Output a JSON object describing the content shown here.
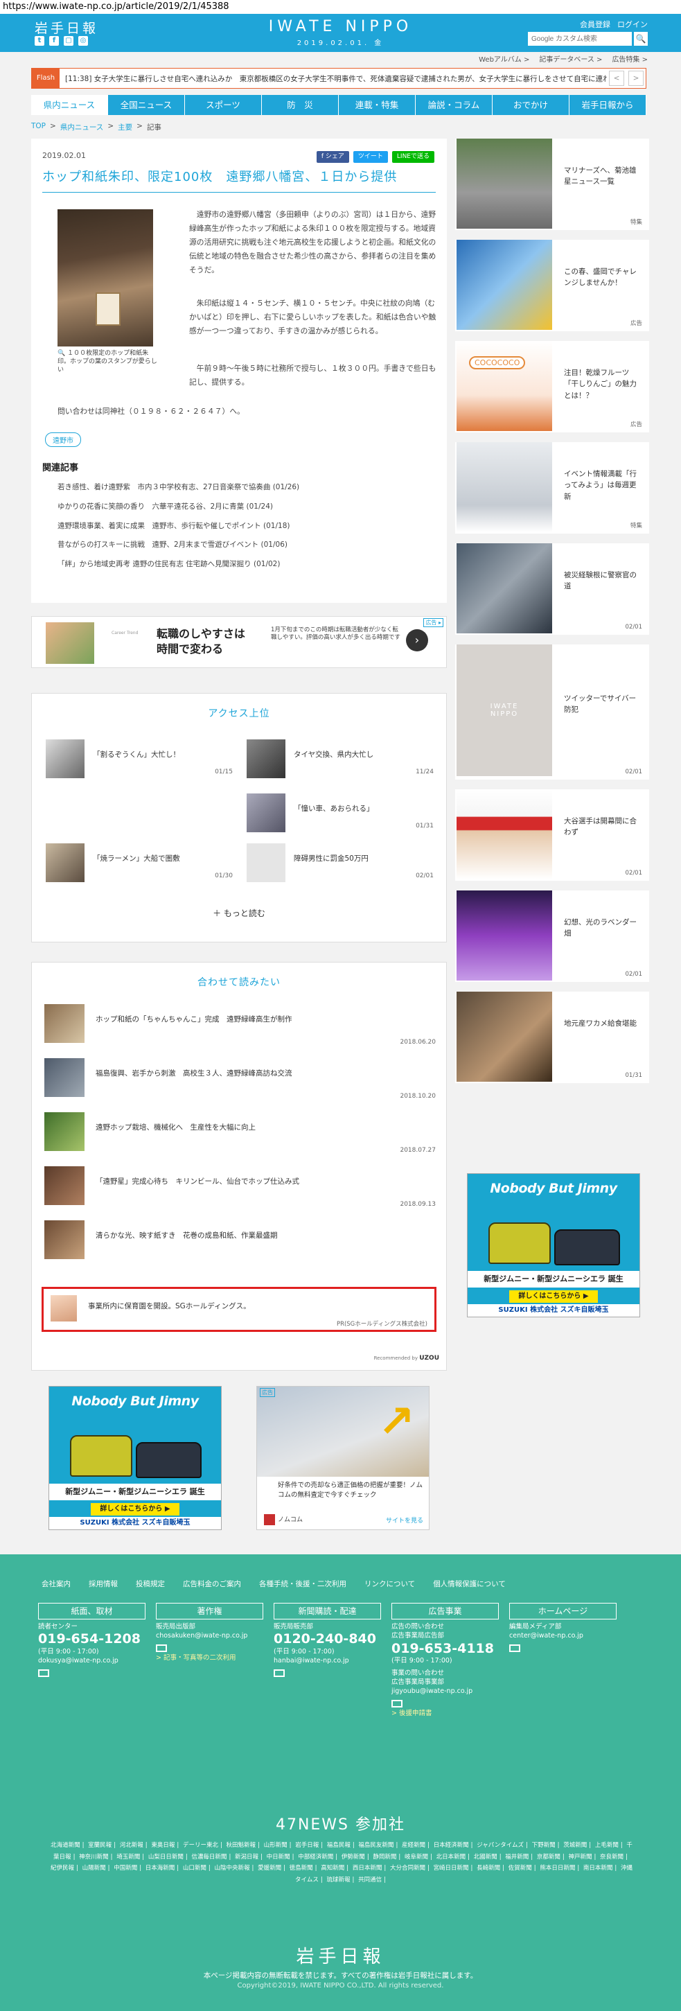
{
  "url": "https://www.iwate-np.co.jp/article/2019/2/1/45388",
  "header": {
    "logo": "岩手日報",
    "social": [
      "t",
      "f",
      "▢",
      "◎"
    ],
    "brand": "IWATE NIPPO",
    "date": "2019.02.01. 金",
    "account": [
      "会員登録",
      "ログイン"
    ],
    "search_placeholder": "Google カスタム検索",
    "search_btn": "🔍",
    "utility": [
      "Webアルバム >",
      "記事データベース >",
      "広告特集 >"
    ]
  },
  "flash": {
    "label": "Flash",
    "text": "[11:38] 女子大学生に暴行しさせ自宅へ連れ込みか　東京都板橋区の女子大学生不明事件で、死体遺棄容疑で逮捕された男が、女子大学生に暴行しをさせて自宅に連れ…",
    "prev": "<",
    "next": ">"
  },
  "nav": [
    "県内ニュース",
    "全国ニュース",
    "スポーツ",
    "防　災",
    "連載・特集",
    "論説・コラム",
    "おでかけ",
    "岩手日報から"
  ],
  "breadcrumb": [
    "TOP",
    ">",
    "県内ニュース",
    ">",
    "主要",
    ">",
    "記事"
  ],
  "article": {
    "date": "2019.02.01",
    "share": [
      "f シェア",
      "ツイート",
      "LINEで送る"
    ],
    "title": "ホップ和紙朱印、限定100枚　遠野郷八幡宮、１日から提供",
    "caption": "１００枚限定のホップ和紙朱印。ホップの葉のスタンプが愛らしい",
    "paragraphs": [
      "遠野市の遠野郷八幡宮（多田頼申（よりのぶ）宮司）は１日から、遠野緑峰高生が作ったホップ和紙による朱印１００枚を限定授与する。地域資源の活用研究に挑戦も注ぐ地元高校生を応援しようと初企画。和紙文化の伝統と地域の特色を融合させた希少性の高さから、参拝者らの注目を集めそうだ。",
      "朱印紙は縦１４・５センチ、横１０・５センチ。中央に社紋の向鳩（むかいばと）印を押し、右下に愛らしいホップを表した。和紙は色合いや触感が一つ一つ違っており、手すきの温かみが感じられる。",
      "午前９時～午後５時に社務所で授与し、１枚３００円。手書きで些日も記し、提供する。"
    ],
    "contact": "問い合わせは同神社（０１９８・６２・２６４７）へ。",
    "tag": "遠野市",
    "related_title": "関連記事",
    "related": [
      "若き感性、着け遠野紫　市内３中学校有志、27日音楽祭で協奏曲 (01/26)",
      "ゆかりの花香に笑顔の香り　六華平遠花る谷、2月に青葉 (01/24)",
      "遠野環境事業、着実に成果　遠野市、歩行転や催しでポイント (01/18)",
      "昔ながらの打スキーに挑戦　遠野、2月末まで雪遊びイベント (01/06)",
      "「絆」から地域史再考 遠野の住民有志 住宅跡へ見聞深掘り (01/02)"
    ]
  },
  "ad_banner": {
    "label": "広告 ▸",
    "brand": "Career Trend",
    "headline_1": "転職のしやすさは",
    "headline_2": "時間で変わる",
    "side": "1月下旬までのこの時期は転職活動者が少なく転職しやすい。評価の高い求人が多く出る時期です",
    "arrow": "›"
  },
  "access": {
    "title": "アクセス上位",
    "items": [
      {
        "text": "「割るぞうくん」大忙し！",
        "date": "01/15"
      },
      {
        "text": "タイヤ交換、県内大忙し",
        "date": "11/24"
      },
      {
        "text": "「憧い車、あおられる」",
        "date": "01/31"
      },
      {
        "text": "「焼ラーメン」大船で圏敷",
        "date": "01/30"
      },
      {
        "text": "障碍男性に罰金50万円",
        "date": "02/01"
      }
    ],
    "more": "＋ もっと読む"
  },
  "recommend": {
    "title": "合わせて読みたい",
    "items": [
      {
        "text": "ホップ和紙の「ちゃんちゃんこ」完成　遠野緑峰高生が制作",
        "date": "2018.06.20"
      },
      {
        "text": "福島復興、岩手から刺激　高校生３人、遠野緑峰高訪ね交流",
        "date": "2018.10.20"
      },
      {
        "text": "遠野ホップ栽培、機械化へ　生産性を大幅に向上",
        "date": "2018.07.27"
      },
      {
        "text": "「遠野星」完成心待ち　キリンビール、仙台でホップ仕込み式",
        "date": "2018.09.13"
      },
      {
        "text": "清らかな光、映す紙すき　花巻の成島和紙、作業最盛期",
        "date": ""
      }
    ],
    "ad": {
      "text": "事業所内に保育園を開設。SGホールディングス。",
      "source": "PR(SGホールディングス株式会社)"
    },
    "powered_label": "Recommended by",
    "powered_brand": "UZOU"
  },
  "sidebar": [
    {
      "text": "マリナーズへ、菊池雄星ニュース一覧",
      "date": "特集"
    },
    {
      "text": "この春、盛岡でチャレンジしませんか！",
      "date": "広告"
    },
    {
      "text": "注目！乾燥フルーツ「干しりんご」の魅力とは！？",
      "date": "広告"
    },
    {
      "text": "イベント情報満載「行ってみよう」は毎週更新",
      "date": "特集"
    },
    {
      "text": "被災経験根に警察官の道",
      "date": "02/01"
    },
    {
      "text": "ツイッターでサイバー防犯",
      "date": "02/01"
    },
    {
      "text": "大谷選手は開幕間に合わず",
      "date": "02/01"
    },
    {
      "text": "幻想、光のラベンダー畑",
      "date": "02/01"
    },
    {
      "text": "地元産ワカメ給食堪能",
      "date": "01/31"
    }
  ],
  "sidebar_thumb_logo": "IWATE\nNIPPO",
  "sidebar_thumb_coco": "COCOCOCO",
  "jimny_ad": {
    "title": "Nobody But Jimny",
    "strip": "新型ジムニー・新型ジムニーシエラ 誕生",
    "cta": "詳しくはこちらから ▶",
    "foot": "SUZUKI 株式会社 スズキ自販埼玉"
  },
  "nomu_ad": {
    "label": "広告",
    "copy": "好条件での売却なら適正価格の把握が重要！ノムコムの無料査定で今すぐチェック",
    "brand": "ノムコム",
    "go": "サイトを見る"
  },
  "footer": {
    "links": [
      "会社案内",
      "採用情報",
      "投稿規定",
      "広告料金のご案内",
      "各種手続・後援・二次利用",
      "リンクについて",
      "個人情報保護について"
    ],
    "cols": [
      {
        "head": "紙面、取材",
        "label": "読者センター",
        "phone": "019-654-1208",
        "hours": "(平日 9:00 - 17:00)",
        "email": "dokusya@iwate-np.co.jp",
        "extra": ""
      },
      {
        "head": "著作権",
        "label": "販売局出版部",
        "phone": "",
        "hours": "",
        "email": "chosakuken@iwate-np.co.jp",
        "extra": "> 記事・写真等の二次利用"
      },
      {
        "head": "新聞購読・配達",
        "label": "販売局販売部",
        "phone": "0120-240-840",
        "hours": "(平日 9:00 - 17:00)",
        "email": "hanbai@iwate-np.co.jp",
        "extra": ""
      },
      {
        "head": "広告事業",
        "label": "広告の問い合わせ\n広告事業局広告部",
        "phone": "019-653-4118",
        "hours": "(平日 9:00 - 17:00)",
        "email": "jigyoubu@iwate-np.co.jp",
        "extra": "事業の問い合わせ\n広告事業局事業部"
      },
      {
        "head": "ホームページ",
        "label": "編集局メディア部",
        "phone": "",
        "hours": "",
        "email": "center@iwate-np.co.jp",
        "extra": ""
      }
    ],
    "jigyo_link": "> 後援申請書",
    "n47": "47NEWS 参加社",
    "papers": [
      "北海道新聞",
      "室蘭民報",
      "河北新報",
      "東奥日報",
      "デーリー東北",
      "秋田魁新報",
      "山形新聞",
      "岩手日報",
      "福島民報",
      "福島民友新聞",
      "産経新聞",
      "日本経済新聞",
      "ジャパンタイムズ",
      "下野新聞",
      "茨城新聞",
      "上毛新聞",
      "千葉日報",
      "神奈川新聞",
      "埼玉新聞",
      "山梨日日新聞",
      "信濃毎日新聞",
      "新潟日報",
      "中日新聞",
      "中部経済新聞",
      "伊勢新聞",
      "静岡新聞",
      "岐阜新聞",
      "北日本新聞",
      "北國新聞",
      "福井新聞",
      "京都新聞",
      "神戸新聞",
      "奈良新聞",
      "紀伊民報",
      "山陽新聞",
      "中国新聞",
      "日本海新聞",
      "山口新聞",
      "山陰中央新報",
      "愛媛新聞",
      "徳島新聞",
      "高知新聞",
      "西日本新聞",
      "大分合同新聞",
      "宮崎日日新聞",
      "長崎新聞",
      "佐賀新聞",
      "熊本日日新聞",
      "南日本新聞",
      "沖縄タイムス",
      "琉球新報",
      "共同通信"
    ],
    "logo": "岩手日報",
    "note": "本ページ掲載内容の無断転載を禁じます。すべての著作権は岩手日報社に属します。",
    "copy": "Copyright©2019, IWATE NIPPO CO.,LTD. All rights reserved."
  }
}
